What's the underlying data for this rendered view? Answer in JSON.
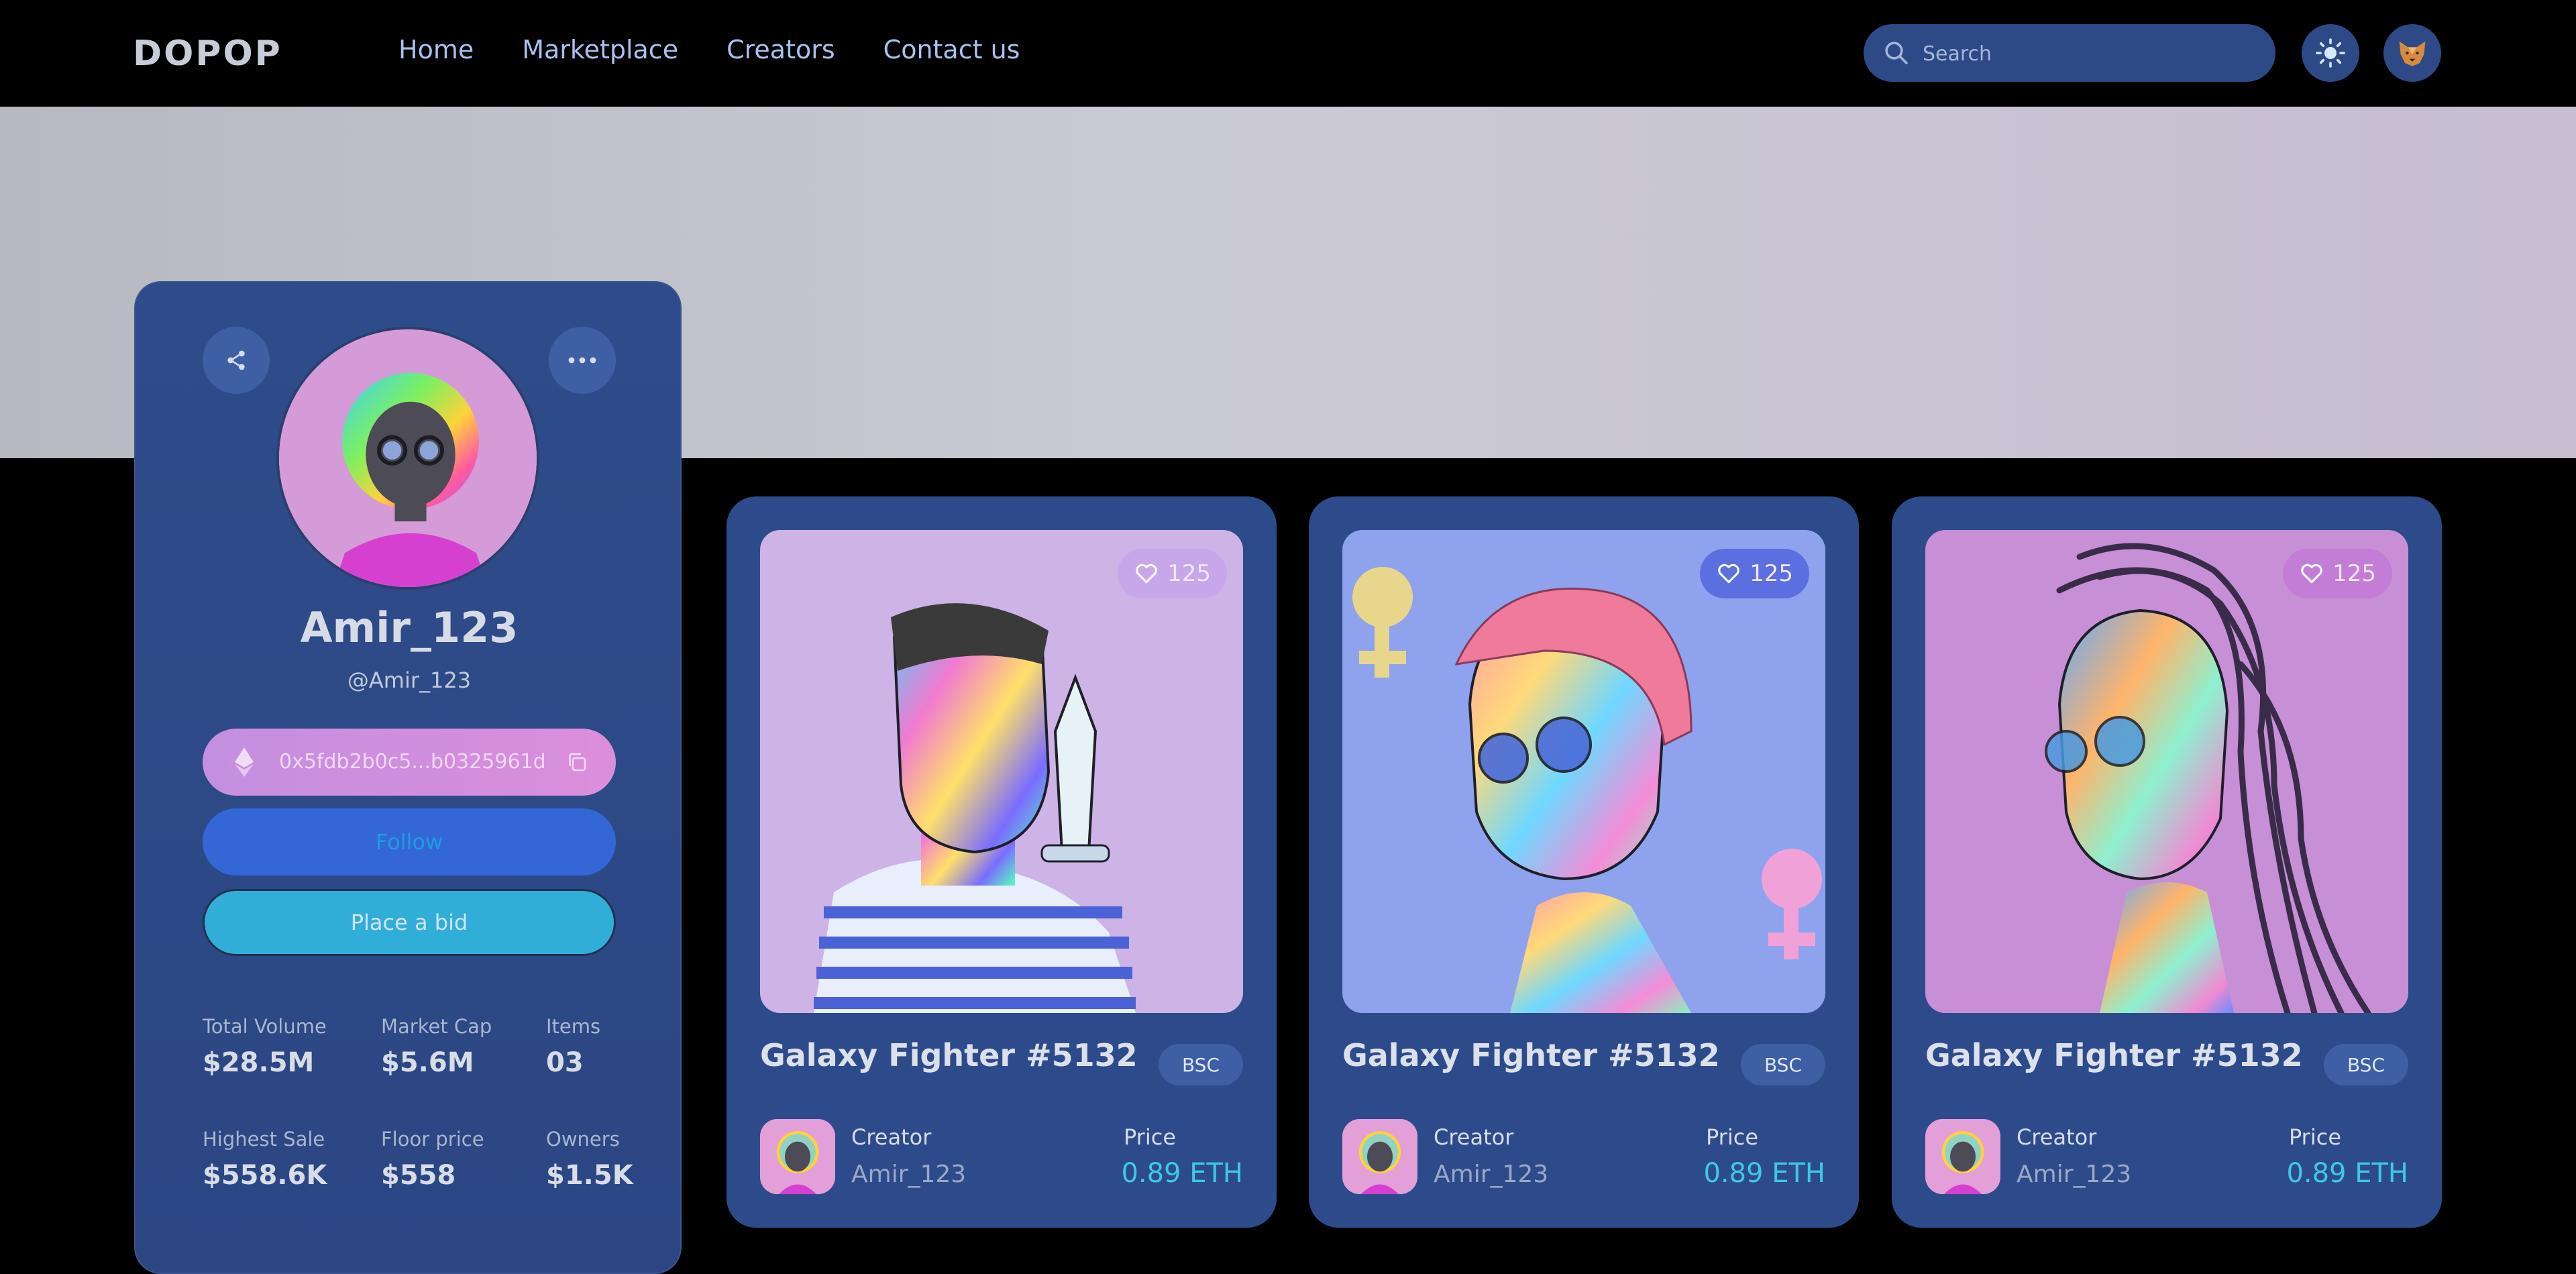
{
  "brand": "DOPOP",
  "nav": {
    "items": [
      "Home",
      "Marketplace",
      "Creators",
      "Contact us"
    ]
  },
  "search": {
    "placeholder": "Search"
  },
  "profile": {
    "name": "Amir_123",
    "handle": "@Amir_123",
    "wallet": "0x5fdb2b0c5...b0325961d",
    "follow_label": "Follow",
    "bid_label": "Place a bid",
    "stats": [
      {
        "label": "Total Volume",
        "value": "$28.5M"
      },
      {
        "label": "Market Cap",
        "value": "$5.6M"
      },
      {
        "label": "Items",
        "value": "03"
      },
      {
        "label": "Highest Sale",
        "value": "$558.6K"
      },
      {
        "label": "Floor price",
        "value": "$558"
      },
      {
        "label": "Owners",
        "value": "$1.5K"
      }
    ]
  },
  "cards": [
    {
      "title": "Galaxy Fighter #5132",
      "chain": "BSC",
      "likes": "125",
      "creator_label": "Creator",
      "creator": "Amir_123",
      "price_label": "Price",
      "price": "0.89 ETH",
      "bg": "#cdb3e6"
    },
    {
      "title": "Galaxy Fighter #5132",
      "chain": "BSC",
      "likes": "125",
      "creator_label": "Creator",
      "creator": "Amir_123",
      "price_label": "Price",
      "price": "0.89 ETH",
      "bg": "#8fa2ee"
    },
    {
      "title": "Galaxy Fighter #5132",
      "chain": "BSC",
      "likes": "125",
      "creator_label": "Creator",
      "creator": "Amir_123",
      "price_label": "Price",
      "price": "0.89 ETH",
      "bg": "#c78fd6"
    }
  ],
  "colors": {
    "accent": "#3fc7e6",
    "card": "#2d4b8b",
    "nav_bg": "#000000"
  }
}
